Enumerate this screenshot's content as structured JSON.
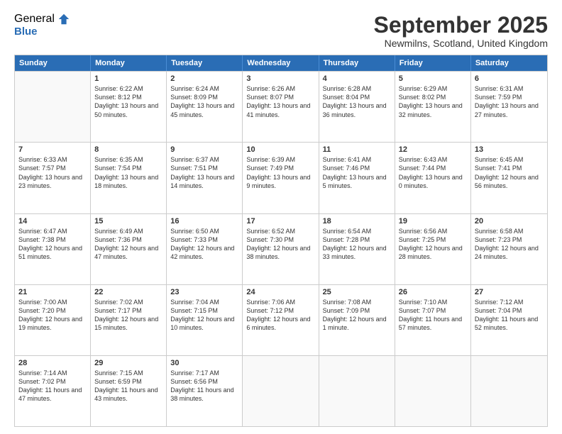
{
  "logo": {
    "general": "General",
    "blue": "Blue"
  },
  "title": "September 2025",
  "location": "Newmilns, Scotland, United Kingdom",
  "header_days": [
    "Sunday",
    "Monday",
    "Tuesday",
    "Wednesday",
    "Thursday",
    "Friday",
    "Saturday"
  ],
  "weeks": [
    [
      {
        "day": "",
        "empty": true
      },
      {
        "day": "1",
        "sunrise": "Sunrise: 6:22 AM",
        "sunset": "Sunset: 8:12 PM",
        "daylight": "Daylight: 13 hours and 50 minutes."
      },
      {
        "day": "2",
        "sunrise": "Sunrise: 6:24 AM",
        "sunset": "Sunset: 8:09 PM",
        "daylight": "Daylight: 13 hours and 45 minutes."
      },
      {
        "day": "3",
        "sunrise": "Sunrise: 6:26 AM",
        "sunset": "Sunset: 8:07 PM",
        "daylight": "Daylight: 13 hours and 41 minutes."
      },
      {
        "day": "4",
        "sunrise": "Sunrise: 6:28 AM",
        "sunset": "Sunset: 8:04 PM",
        "daylight": "Daylight: 13 hours and 36 minutes."
      },
      {
        "day": "5",
        "sunrise": "Sunrise: 6:29 AM",
        "sunset": "Sunset: 8:02 PM",
        "daylight": "Daylight: 13 hours and 32 minutes."
      },
      {
        "day": "6",
        "sunrise": "Sunrise: 6:31 AM",
        "sunset": "Sunset: 7:59 PM",
        "daylight": "Daylight: 13 hours and 27 minutes."
      }
    ],
    [
      {
        "day": "7",
        "sunrise": "Sunrise: 6:33 AM",
        "sunset": "Sunset: 7:57 PM",
        "daylight": "Daylight: 13 hours and 23 minutes."
      },
      {
        "day": "8",
        "sunrise": "Sunrise: 6:35 AM",
        "sunset": "Sunset: 7:54 PM",
        "daylight": "Daylight: 13 hours and 18 minutes."
      },
      {
        "day": "9",
        "sunrise": "Sunrise: 6:37 AM",
        "sunset": "Sunset: 7:51 PM",
        "daylight": "Daylight: 13 hours and 14 minutes."
      },
      {
        "day": "10",
        "sunrise": "Sunrise: 6:39 AM",
        "sunset": "Sunset: 7:49 PM",
        "daylight": "Daylight: 13 hours and 9 minutes."
      },
      {
        "day": "11",
        "sunrise": "Sunrise: 6:41 AM",
        "sunset": "Sunset: 7:46 PM",
        "daylight": "Daylight: 13 hours and 5 minutes."
      },
      {
        "day": "12",
        "sunrise": "Sunrise: 6:43 AM",
        "sunset": "Sunset: 7:44 PM",
        "daylight": "Daylight: 13 hours and 0 minutes."
      },
      {
        "day": "13",
        "sunrise": "Sunrise: 6:45 AM",
        "sunset": "Sunset: 7:41 PM",
        "daylight": "Daylight: 12 hours and 56 minutes."
      }
    ],
    [
      {
        "day": "14",
        "sunrise": "Sunrise: 6:47 AM",
        "sunset": "Sunset: 7:38 PM",
        "daylight": "Daylight: 12 hours and 51 minutes."
      },
      {
        "day": "15",
        "sunrise": "Sunrise: 6:49 AM",
        "sunset": "Sunset: 7:36 PM",
        "daylight": "Daylight: 12 hours and 47 minutes."
      },
      {
        "day": "16",
        "sunrise": "Sunrise: 6:50 AM",
        "sunset": "Sunset: 7:33 PM",
        "daylight": "Daylight: 12 hours and 42 minutes."
      },
      {
        "day": "17",
        "sunrise": "Sunrise: 6:52 AM",
        "sunset": "Sunset: 7:30 PM",
        "daylight": "Daylight: 12 hours and 38 minutes."
      },
      {
        "day": "18",
        "sunrise": "Sunrise: 6:54 AM",
        "sunset": "Sunset: 7:28 PM",
        "daylight": "Daylight: 12 hours and 33 minutes."
      },
      {
        "day": "19",
        "sunrise": "Sunrise: 6:56 AM",
        "sunset": "Sunset: 7:25 PM",
        "daylight": "Daylight: 12 hours and 28 minutes."
      },
      {
        "day": "20",
        "sunrise": "Sunrise: 6:58 AM",
        "sunset": "Sunset: 7:23 PM",
        "daylight": "Daylight: 12 hours and 24 minutes."
      }
    ],
    [
      {
        "day": "21",
        "sunrise": "Sunrise: 7:00 AM",
        "sunset": "Sunset: 7:20 PM",
        "daylight": "Daylight: 12 hours and 19 minutes."
      },
      {
        "day": "22",
        "sunrise": "Sunrise: 7:02 AM",
        "sunset": "Sunset: 7:17 PM",
        "daylight": "Daylight: 12 hours and 15 minutes."
      },
      {
        "day": "23",
        "sunrise": "Sunrise: 7:04 AM",
        "sunset": "Sunset: 7:15 PM",
        "daylight": "Daylight: 12 hours and 10 minutes."
      },
      {
        "day": "24",
        "sunrise": "Sunrise: 7:06 AM",
        "sunset": "Sunset: 7:12 PM",
        "daylight": "Daylight: 12 hours and 6 minutes."
      },
      {
        "day": "25",
        "sunrise": "Sunrise: 7:08 AM",
        "sunset": "Sunset: 7:09 PM",
        "daylight": "Daylight: 12 hours and 1 minute."
      },
      {
        "day": "26",
        "sunrise": "Sunrise: 7:10 AM",
        "sunset": "Sunset: 7:07 PM",
        "daylight": "Daylight: 11 hours and 57 minutes."
      },
      {
        "day": "27",
        "sunrise": "Sunrise: 7:12 AM",
        "sunset": "Sunset: 7:04 PM",
        "daylight": "Daylight: 11 hours and 52 minutes."
      }
    ],
    [
      {
        "day": "28",
        "sunrise": "Sunrise: 7:14 AM",
        "sunset": "Sunset: 7:02 PM",
        "daylight": "Daylight: 11 hours and 47 minutes."
      },
      {
        "day": "29",
        "sunrise": "Sunrise: 7:15 AM",
        "sunset": "Sunset: 6:59 PM",
        "daylight": "Daylight: 11 hours and 43 minutes."
      },
      {
        "day": "30",
        "sunrise": "Sunrise: 7:17 AM",
        "sunset": "Sunset: 6:56 PM",
        "daylight": "Daylight: 11 hours and 38 minutes."
      },
      {
        "day": "",
        "empty": true
      },
      {
        "day": "",
        "empty": true
      },
      {
        "day": "",
        "empty": true
      },
      {
        "day": "",
        "empty": true
      }
    ]
  ]
}
